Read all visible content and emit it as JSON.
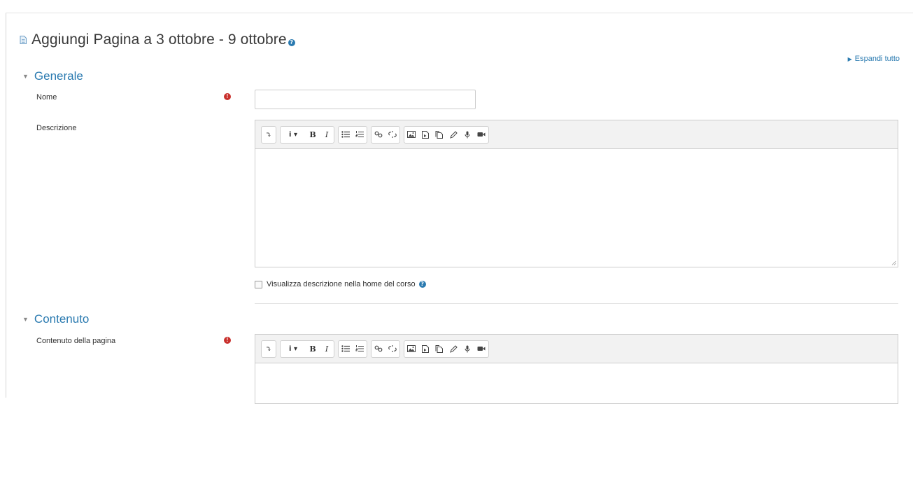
{
  "page": {
    "title": "Aggiungi Pagina a 3 ottobre - 9 ottobre",
    "help_glyph": "?",
    "expand_all": "Espandi tutto"
  },
  "sections": {
    "general": {
      "legend": "Generale",
      "name_label": "Nome",
      "name_value": "",
      "required_glyph": "!",
      "description_label": "Descrizione",
      "show_description_label": "Visualizza descrizione nella home del corso"
    },
    "content": {
      "legend": "Contenuto",
      "page_content_label": "Contenuto della pagina",
      "required_glyph": "!"
    }
  },
  "toolbar": {
    "collapse": "⤵",
    "style": "i ▾",
    "bold": "B",
    "italic": "I"
  },
  "colors": {
    "accent": "#2a7ab0",
    "required": "#c9302c",
    "toolbar_bg": "#f2f2f2"
  }
}
